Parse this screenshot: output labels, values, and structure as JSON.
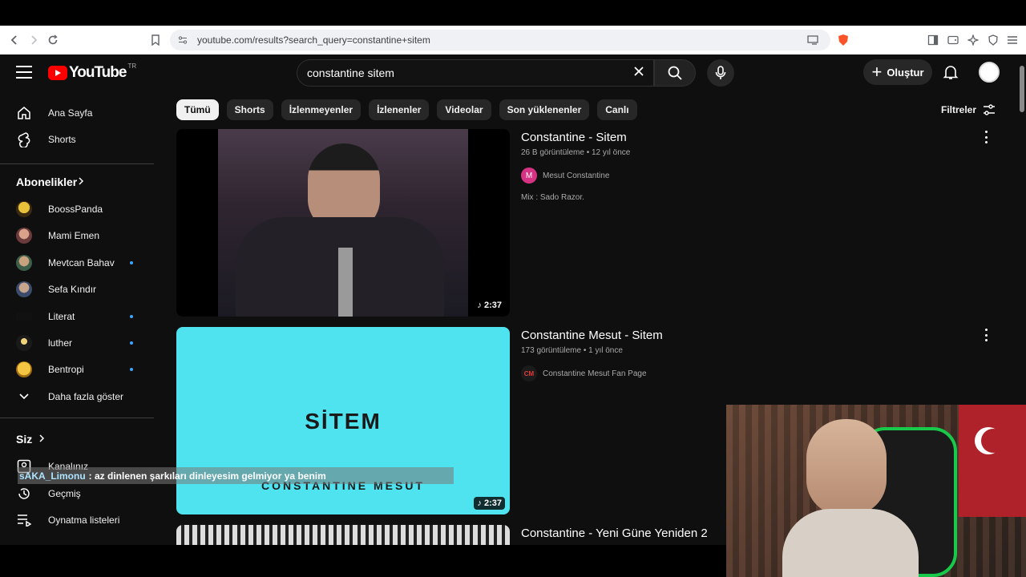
{
  "browser": {
    "url": "youtube.com/results?search_query=constantine+sitem"
  },
  "header": {
    "logo_text": "YouTube",
    "country_code": "TR",
    "search_value": "constantine sitem",
    "create_label": "Oluştur"
  },
  "sidebar": {
    "home": "Ana Sayfa",
    "shorts": "Shorts",
    "subscriptions_title": "Abonelikler",
    "subscriptions": [
      {
        "name": "BoossPanda",
        "live": false
      },
      {
        "name": "Mami Emen",
        "live": false
      },
      {
        "name": "Mevtcan Bahav",
        "live": true
      },
      {
        "name": "Sefa Kındır",
        "live": false
      },
      {
        "name": "Literat",
        "live": true
      },
      {
        "name": "luther",
        "live": true
      },
      {
        "name": "Bentropi",
        "live": true
      }
    ],
    "show_more": "Daha fazla göster",
    "you_title": "Siz",
    "your_channel": "Kanalınız",
    "history": "Geçmiş",
    "playlists": "Oynatma listeleri"
  },
  "chips": [
    "Tümü",
    "Shorts",
    "İzlenmeyenler",
    "İzlenenler",
    "Videolar",
    "Son yüklenenler",
    "Canlı"
  ],
  "filters_label": "Filtreler",
  "results": [
    {
      "title": "Constantine - Sitem",
      "meta": "26 B görüntüleme • 12 yıl önce",
      "channel": "Mesut Constantine",
      "channel_initial": "M",
      "description": "Mix : Sado Razor.",
      "duration": "2:37"
    },
    {
      "title": "Constantine Mesut - Sitem",
      "meta": "173 görüntüleme • 1 yıl önce",
      "channel": "Constantine Mesut Fan Page",
      "channel_initial": "CM",
      "thumb_title": "SİTEM",
      "thumb_subtitle": "CONSTANTINE MESUT",
      "duration": "2:37"
    },
    {
      "title": "Constantine - Yeni Güne Yeniden 2"
    }
  ],
  "chat": {
    "user": "sAKA_Limonu",
    "message": ": az dinlenen şarkıları dinleyesim gelmiyor ya benim"
  },
  "colors": {
    "yt_red": "#ff0000",
    "thumb2_bg": "#4fe3f0",
    "live_dot": "#3ea6ff"
  }
}
